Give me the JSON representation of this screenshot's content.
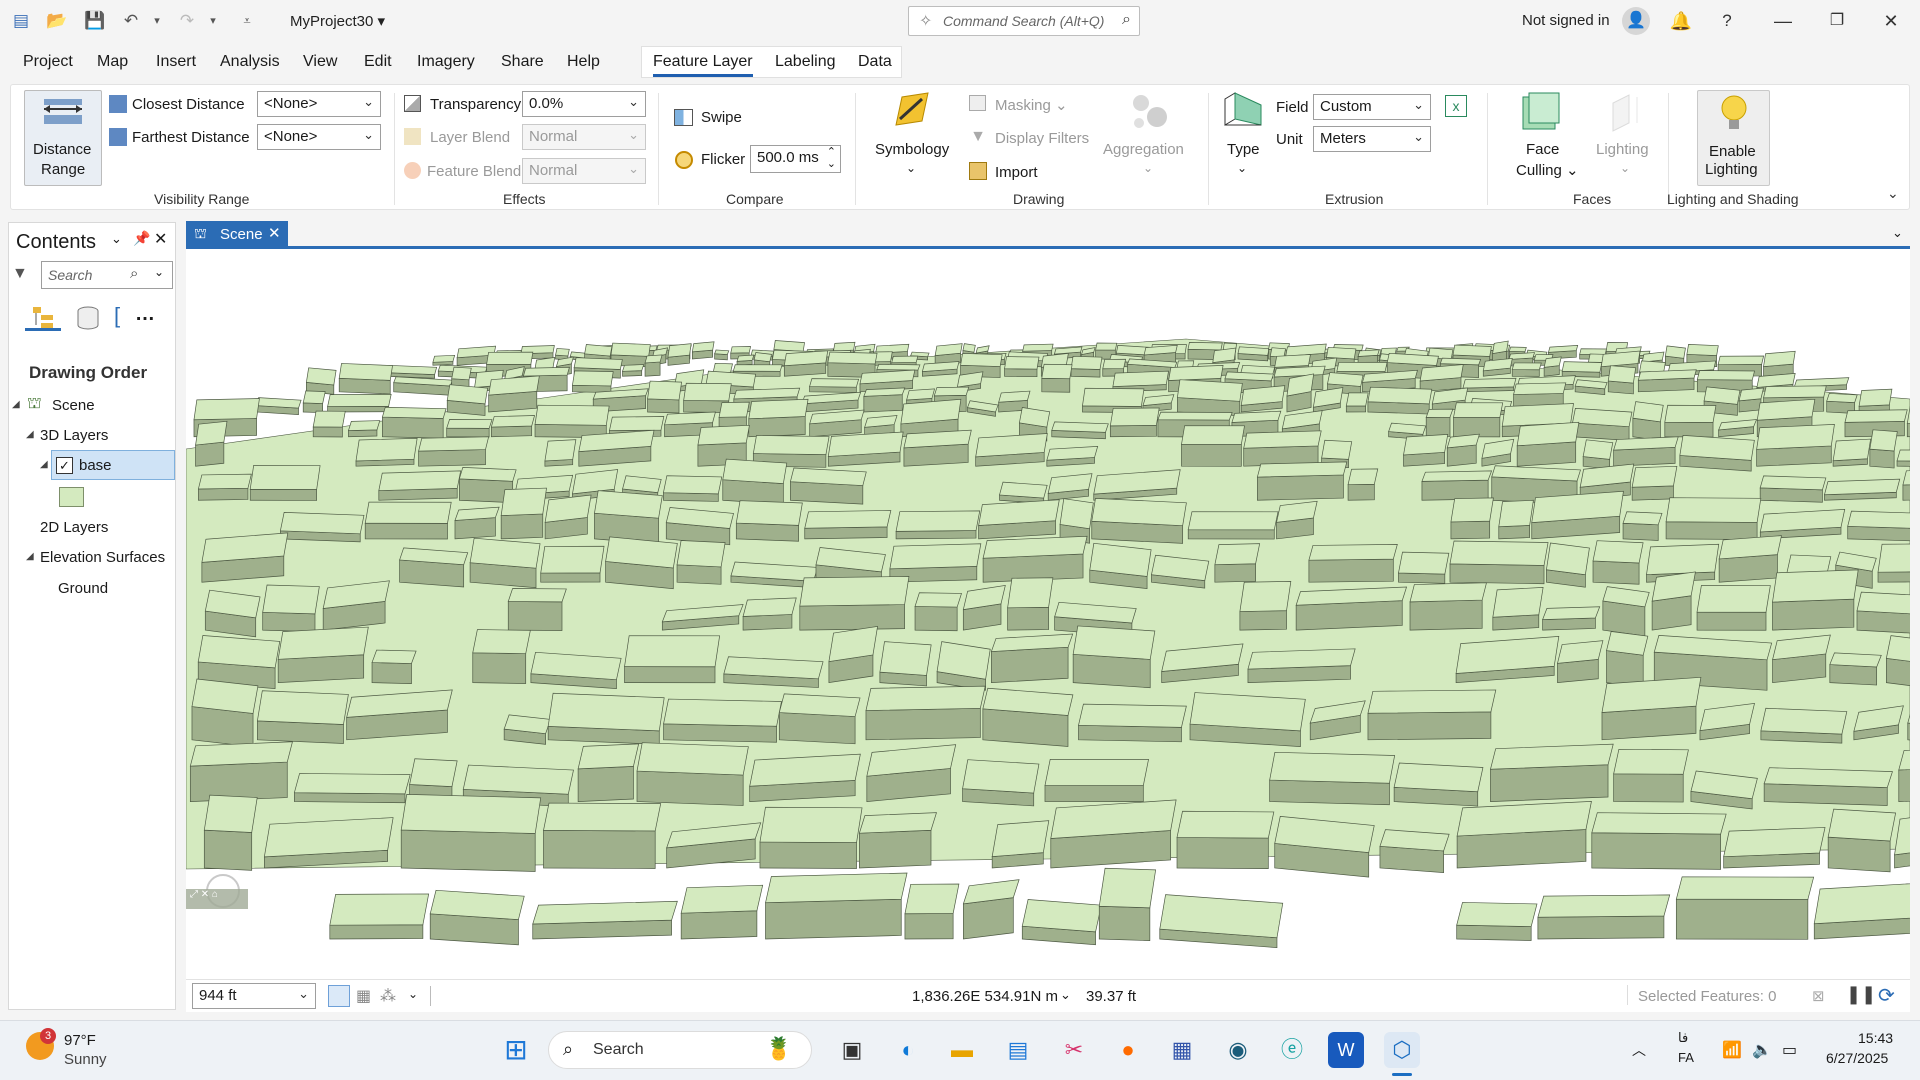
{
  "titlebar": {
    "project_name": "MyProject30",
    "command_search_placeholder": "Command Search (Alt+Q)",
    "signed_in_status": "Not signed in",
    "help": "?"
  },
  "menu": [
    "Project",
    "Map",
    "Insert",
    "Analysis",
    "View",
    "Edit",
    "Imagery",
    "Share",
    "Help"
  ],
  "context_tabs": [
    "Feature Layer",
    "Labeling",
    "Data"
  ],
  "ribbon": {
    "visibility_range": {
      "group_label": "Visibility Range",
      "distance_range_l1": "Distance",
      "distance_range_l2": "Range",
      "closest_label": "Closest Distance",
      "closest_value": "<None>",
      "farthest_label": "Farthest Distance",
      "farthest_value": "<None>"
    },
    "effects": {
      "group_label": "Effects",
      "transparency_label": "Transparency",
      "transparency_value": "0.0%",
      "layer_blend_label": "Layer Blend",
      "layer_blend_value": "Normal",
      "feature_blend_label": "Feature Blend",
      "feature_blend_value": "Normal"
    },
    "compare": {
      "group_label": "Compare",
      "swipe_label": "Swipe",
      "flicker_label": "Flicker",
      "flicker_value": "500.0  ms"
    },
    "drawing": {
      "group_label": "Drawing",
      "symbology": "Symbology",
      "masking": "Masking",
      "display_filters": "Display Filters",
      "import": "Import",
      "aggregation": "Aggregation"
    },
    "extrusion": {
      "group_label": "Extrusion",
      "type": "Type",
      "field_label": "Field",
      "field_value": "Custom",
      "unit_label": "Unit",
      "unit_value": "Meters"
    },
    "faces": {
      "group_label": "Faces",
      "face_culling_l1": "Face",
      "face_culling_l2": "Culling",
      "lighting": "Lighting"
    },
    "lighting_shading": {
      "group_label": "Lighting and Shading",
      "enable_l1": "Enable",
      "enable_l2": "Lighting"
    }
  },
  "contents": {
    "title": "Contents",
    "search_placeholder": "Search",
    "section": "Drawing Order",
    "tree": {
      "scene": "Scene",
      "layers_3d": "3D Layers",
      "base": "base",
      "layers_2d": "2D Layers",
      "elevation": "Elevation Surfaces",
      "ground": "Ground"
    }
  },
  "map": {
    "tab_label": "Scene",
    "scale": "944 ft",
    "coordinates": "1,836.26E 534.91N m",
    "elevation": "39.37 ft",
    "selected_features": "Selected Features: 0",
    "building_color": "#d4eabf",
    "building_side": "#9fb08c",
    "building_edge": "#4e5a44"
  },
  "taskbar": {
    "weather_temp": "97°F",
    "weather_desc": "Sunny",
    "weather_badge": "3",
    "search_label": "Search",
    "lang_top": "فا",
    "lang_bottom": "FA",
    "time": "15:43",
    "date": "6/27/2025"
  },
  "colors": {
    "accent": "#2b6cb5",
    "ribbon_bg": "#ffffff",
    "app_bg": "#f4f4f4"
  }
}
